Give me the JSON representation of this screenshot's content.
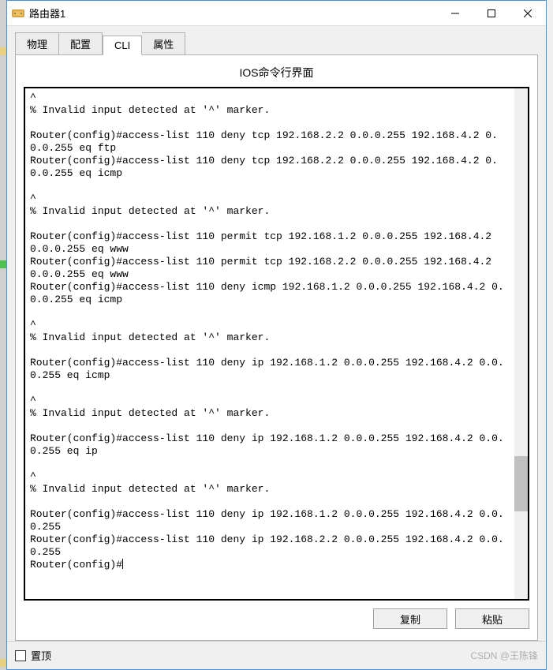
{
  "window": {
    "title": "路由器1"
  },
  "tabs": {
    "physical": "物理",
    "config": "配置",
    "cli": "CLI",
    "attributes": "属性"
  },
  "panel": {
    "title": "IOS命令行界面"
  },
  "terminal": {
    "content": "^\n% Invalid input detected at '^' marker.\n\nRouter(config)#access-list 110 deny tcp 192.168.2.2 0.0.0.255 192.168.4.2 0.0.0.255 eq ftp\nRouter(config)#access-list 110 deny tcp 192.168.2.2 0.0.0.255 192.168.4.2 0.0.0.255 eq icmp\n\n^\n% Invalid input detected at '^' marker.\n\nRouter(config)#access-list 110 permit tcp 192.168.1.2 0.0.0.255 192.168.4.2 0.0.0.255 eq www\nRouter(config)#access-list 110 permit tcp 192.168.2.2 0.0.0.255 192.168.4.2 0.0.0.255 eq www\nRouter(config)#access-list 110 deny icmp 192.168.1.2 0.0.0.255 192.168.4.2 0.0.0.255 eq icmp\n\n^\n% Invalid input detected at '^' marker.\n\nRouter(config)#access-list 110 deny ip 192.168.1.2 0.0.0.255 192.168.4.2 0.0.0.255 eq icmp\n\n^\n% Invalid input detected at '^' marker.\n\nRouter(config)#access-list 110 deny ip 192.168.1.2 0.0.0.255 192.168.4.2 0.0.0.255 eq ip\n\n^\n% Invalid input detected at '^' marker.\n\nRouter(config)#access-list 110 deny ip 192.168.1.2 0.0.0.255 192.168.4.2 0.0.0.255\nRouter(config)#access-list 110 deny ip 192.168.2.2 0.0.0.255 192.168.4.2 0.0.0.255\nRouter(config)#"
  },
  "buttons": {
    "copy": "复制",
    "paste": "粘贴"
  },
  "footer": {
    "option": "置顶",
    "watermark": "CSDN @王陈锋"
  }
}
